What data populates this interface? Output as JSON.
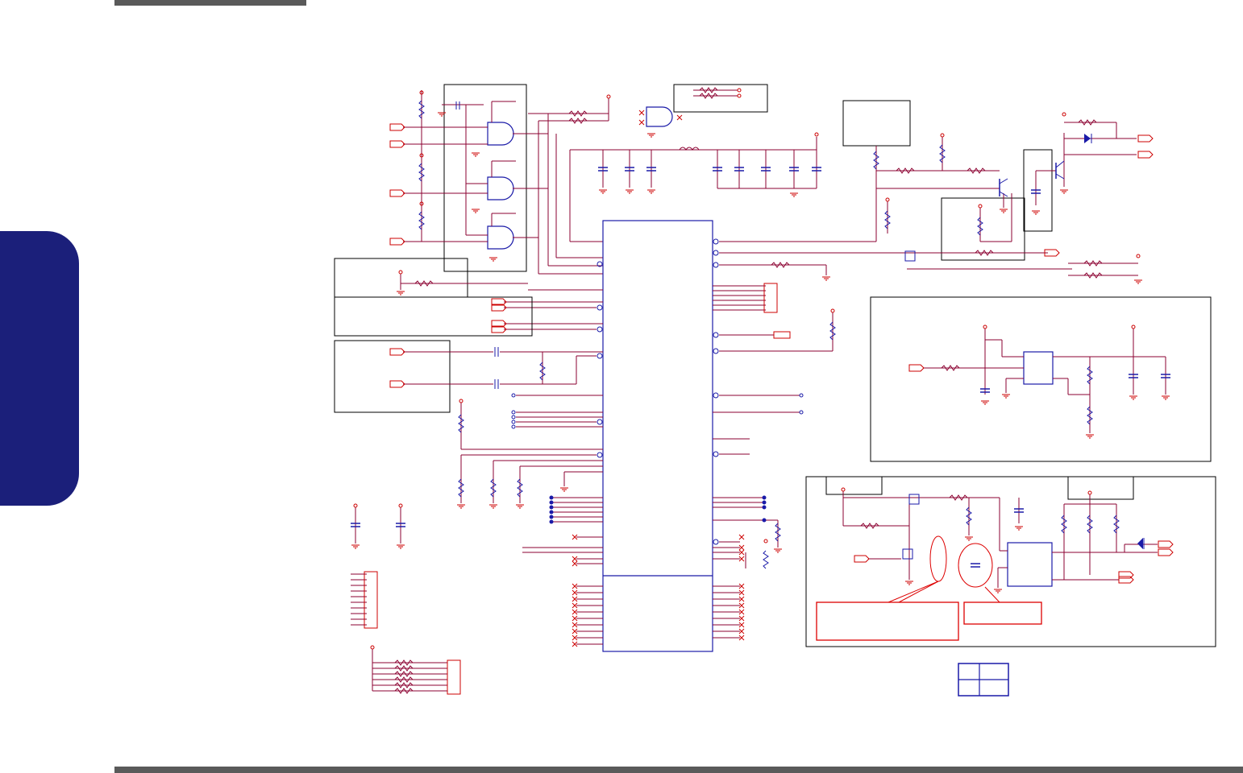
{
  "page": {
    "section_tab_label": ""
  },
  "colors": {
    "wire": "#8b0030",
    "component_blue": "#1a1aa8",
    "power_red": "#cc0000",
    "box_black": "#000000",
    "annotation_red": "#dd0000",
    "tab_navy": "#1b1f7a",
    "bar_gray": "#5a5a5a"
  },
  "schematic": {
    "blocks": [
      {
        "id": "and-gate-group",
        "kind": "and-gate-array",
        "gates": 3
      },
      {
        "id": "main-ic",
        "kind": "ic-chip"
      },
      {
        "id": "regulator-block",
        "kind": "voltage-regulator"
      },
      {
        "id": "charger-block",
        "kind": "power-switch-circuit"
      },
      {
        "id": "transistor-block",
        "kind": "transistor-switch"
      },
      {
        "id": "title-grid",
        "kind": "table-grid",
        "rows": 2,
        "cols": 2
      }
    ],
    "annotations": [
      {
        "id": "note-left",
        "text": ""
      },
      {
        "id": "note-right",
        "text": ""
      }
    ]
  }
}
